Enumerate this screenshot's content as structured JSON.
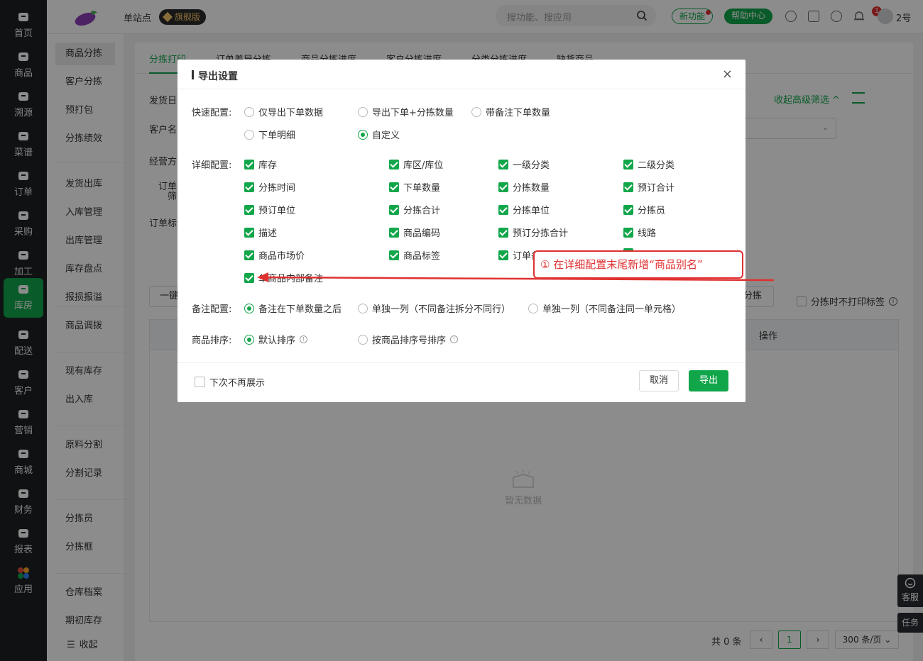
{
  "nav": {
    "items": [
      {
        "label": "首页",
        "icon": "home-icon"
      },
      {
        "label": "商品",
        "icon": "product-icon"
      },
      {
        "label": "溯源",
        "icon": "trace-icon"
      },
      {
        "label": "菜谱",
        "icon": "recipe-icon"
      },
      {
        "label": "订单",
        "icon": "order-icon"
      },
      {
        "label": "采购",
        "icon": "cart-icon"
      },
      {
        "label": "加工",
        "icon": "process-icon"
      },
      {
        "label": "库房",
        "icon": "warehouse-icon"
      },
      {
        "label": "配送",
        "icon": "delivery-icon"
      },
      {
        "label": "客户",
        "icon": "customer-icon"
      },
      {
        "label": "营销",
        "icon": "marketing-icon"
      },
      {
        "label": "商城",
        "icon": "mall-icon"
      },
      {
        "label": "财务",
        "icon": "finance-icon"
      },
      {
        "label": "报表",
        "icon": "report-icon"
      },
      {
        "label": "应用",
        "icon": "apps-icon"
      }
    ]
  },
  "topbar": {
    "site": "单站点",
    "edition": "旗舰版",
    "search_placeholder": "搜功能、搜应用",
    "new_feature": "新功能",
    "help_center": "帮助中心",
    "notif_count": "1",
    "user": "2号"
  },
  "submenu": {
    "items": [
      "商品分拣",
      "客户分拣",
      "预打包",
      "分拣绩效",
      "发货出库",
      "入库管理",
      "出库管理",
      "库存盘点",
      "报损报溢",
      "商品调拨",
      "现有库存",
      "出入库",
      "原料分割",
      "分割记录",
      "分拣员",
      "分拣框",
      "仓库档案",
      "期初库存"
    ],
    "collapse": "收起"
  },
  "tabs": [
    "分拣打印",
    "订单差异分拣",
    "商品分拣进度",
    "客户分拣进度",
    "分类分拣进度",
    "缺货商品"
  ],
  "filters": {
    "label_date": "发货日",
    "label_customer": "客户名",
    "label_operator": "经营方",
    "label_order_a": "订单",
    "label_order_b": "筛",
    "label_order_tag": "订单标",
    "collapse_filter": "收起高级筛选",
    "one_key": "一键",
    "sort_btn": "分拣",
    "no_print_label": "分拣时不打印标签",
    "col_action": "操作",
    "empty": "暂无数据"
  },
  "pagination": {
    "total": "共 0 条",
    "page": "1",
    "page_size": "300 条/页"
  },
  "side_float": {
    "service": "客服",
    "task": "任务"
  },
  "modal": {
    "title": "导出设置",
    "quick_label": "快速配置:",
    "quick_options": [
      "仅导出下单数据",
      "导出下单+分拣数量",
      "带备注下单数量",
      "下单明细",
      "自定义"
    ],
    "detail_label": "详细配置:",
    "detail_options": [
      "库存",
      "库区/库位",
      "一级分类",
      "二级分类",
      "分拣时间",
      "下单数量",
      "分拣数量",
      "预订合计",
      "预订单位",
      "分拣合计",
      "分拣单位",
      "分拣员",
      "描述",
      "商品编码",
      "预订分拣合计",
      "线路",
      "商品市场价",
      "商品标签",
      "订单备",
      "",
      "单商品内部备注"
    ],
    "remark_label": "备注配置:",
    "remark_options": [
      "备注在下单数量之后",
      "单独一列（不同备注拆分不同行）",
      "单独一列（不同备注同一单元格）"
    ],
    "sort_label": "商品排序:",
    "sort_options": [
      "默认排序",
      "按商品排序号排序"
    ],
    "dont_show": "下次不再展示",
    "cancel": "取消",
    "export": "导出"
  },
  "annotation": {
    "text": "① 在详细配置末尾新增“商品别名”",
    "color": "#e03131"
  },
  "colors": {
    "brand": "#12a64b",
    "nav_bg": "#1d1f24"
  }
}
